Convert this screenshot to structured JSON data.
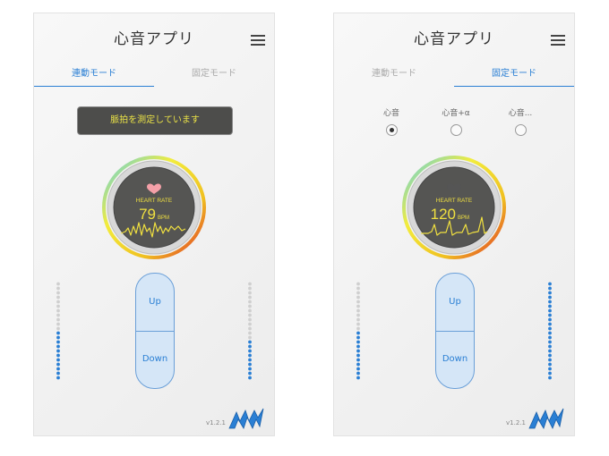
{
  "app": {
    "title": "心音アプリ",
    "version": "v1.2.1",
    "accent_color": "#2a7fd4",
    "text_yellow": "#f0e040"
  },
  "screens": [
    {
      "tabs": [
        {
          "label": "連動モード",
          "active": true
        },
        {
          "label": "固定モード",
          "active": false
        }
      ],
      "status_message": "脈拍を測定しています",
      "gauge": {
        "heart_icon": "heart-icon",
        "label": "HEART RATE",
        "bpm": "79",
        "unit": "BPM",
        "heart_color": "#f4a0a8"
      },
      "buttons": {
        "up": "Up",
        "down": "Down"
      },
      "left_level": 0.48,
      "right_level": 0.42
    },
    {
      "tabs": [
        {
          "label": "連動モード",
          "active": false
        },
        {
          "label": "固定モード",
          "active": true
        }
      ],
      "radios": [
        {
          "label": "心音",
          "selected": true
        },
        {
          "label": "心音+α",
          "selected": false
        },
        {
          "label": "心音...",
          "selected": false
        }
      ],
      "gauge": {
        "heart_icon": "heart-icon",
        "label": "HEART RATE",
        "bpm": "120",
        "unit": "BPM",
        "heart_color": "#555555"
      },
      "buttons": {
        "up": "Up",
        "down": "Down"
      },
      "left_level": 0.5,
      "right_level": 1.0
    }
  ]
}
